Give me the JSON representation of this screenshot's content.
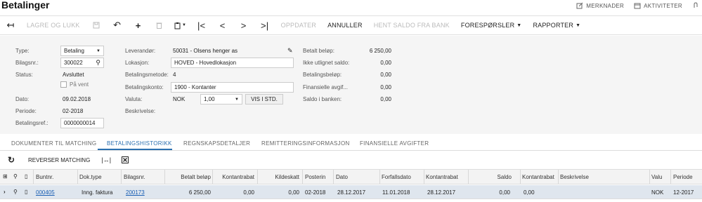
{
  "page": {
    "title": "Betalinger"
  },
  "top_links": {
    "notes": "MERKNADER",
    "activities": "AKTIVITETER"
  },
  "toolbar": {
    "save_close": "LAGRE OG LUKK",
    "update": "OPPDATER",
    "cancel": "ANNULLER",
    "fetch_balance": "HENT SALDO FRA BANK",
    "inquiries": "FORESPØRSLER",
    "reports": "RAPPORTER"
  },
  "form": {
    "type_label": "Type:",
    "type_value": "Betaling",
    "refnr_label": "Bilagsnr.:",
    "refnr_value": "300022",
    "status_label": "Status:",
    "status_value": "Avsluttet",
    "hold_label": "På vent",
    "date_label": "Dato:",
    "date_value": "09.02.2018",
    "period_label": "Periode:",
    "period_value": "02-2018",
    "payref_label": "Betalingsref.:",
    "payref_value": "0000000014",
    "vendor_label": "Leverandør:",
    "vendor_value": "50031 - Olsens henger as",
    "location_label": "Lokasjon:",
    "location_value": "HOVED - Hovedlokasjon",
    "method_label": "Betalingsmetode:",
    "method_value": "4",
    "account_label": "Betalingskonto:",
    "account_value": "1900 - Kontanter",
    "currency_label": "Valuta:",
    "currency_value": "NOK",
    "rate_value": "1,00",
    "view_base": "VIS I STD.",
    "desc_label": "Beskrivelse:",
    "paid_label": "Betalt beløp:",
    "paid_value": "6 250,00",
    "unapplied_label": "Ikke utlignet saldo:",
    "unapplied_value": "0,00",
    "payment_amount_label": "Betalingsbeløp:",
    "payment_amount_value": "0,00",
    "fin_charges_label": "Finansielle avgif...",
    "fin_charges_value": "0,00",
    "bank_balance_label": "Saldo i banken:",
    "bank_balance_value": "0,00"
  },
  "tabs": [
    "DOKUMENTER TIL MATCHING",
    "BETALINGSHISTORIKK",
    "REGNSKAPSDETALJER",
    "REMITTERINGSINFORMASJON",
    "FINANSIELLE AVGIFTER"
  ],
  "active_tab": "BETALINGSHISTORIKK",
  "grid_toolbar": {
    "reverse_matching": "REVERSER MATCHING"
  },
  "grid": {
    "columns": [
      "Buntnr.",
      "Dok.type",
      "Bilagsnr.",
      "Betalt beløp",
      "Kontantrabat",
      "Kildeskatt",
      "Posterin",
      "Dato",
      "Forfallsdato",
      "Kontantrabat",
      "Saldo",
      "Kontantrabat",
      "Beskrivelse",
      "Valu",
      "Periode"
    ],
    "rows": [
      [
        "000405",
        "Inng. faktura",
        "200173",
        "6 250,00",
        "0,00",
        "0,00",
        "02-2018",
        "28.12.2017",
        "11.01.2018",
        "28.12.2017",
        "0,00",
        "0,00",
        "",
        "NOK",
        "12-2017"
      ]
    ]
  },
  "colors": {
    "accent": "#2a6fb0",
    "selected_row": "#dfe6ee",
    "form_bg": "#f5f5f5"
  }
}
